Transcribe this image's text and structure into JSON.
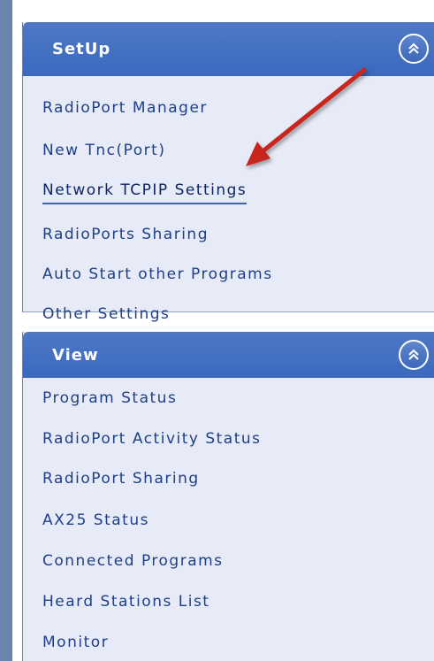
{
  "setup": {
    "title": "SetUp",
    "items": [
      {
        "label": "RadioPort Manager"
      },
      {
        "label": "New Tnc(Port)"
      },
      {
        "label": "Network TCPIP Settings",
        "selected": true
      },
      {
        "label": "RadioPorts Sharing"
      },
      {
        "label": "Auto Start other Programs"
      },
      {
        "label": "Other Settings"
      }
    ]
  },
  "view": {
    "title": "View",
    "items": [
      {
        "label": "Program Status"
      },
      {
        "label": "RadioPort Activity Status"
      },
      {
        "label": "RadioPort Sharing"
      },
      {
        "label": "AX25 Status"
      },
      {
        "label": "Connected Programs"
      },
      {
        "label": "Heard Stations List"
      },
      {
        "label": "Monitor"
      }
    ]
  },
  "icons": {
    "collapse": "double-chevron-up-icon",
    "annotation": "red-arrow"
  },
  "colors": {
    "header": "#3f6cc0",
    "panel_bg": "#e7ebf7",
    "link_text": "#1e3f88",
    "arrow": "#c8281e"
  }
}
